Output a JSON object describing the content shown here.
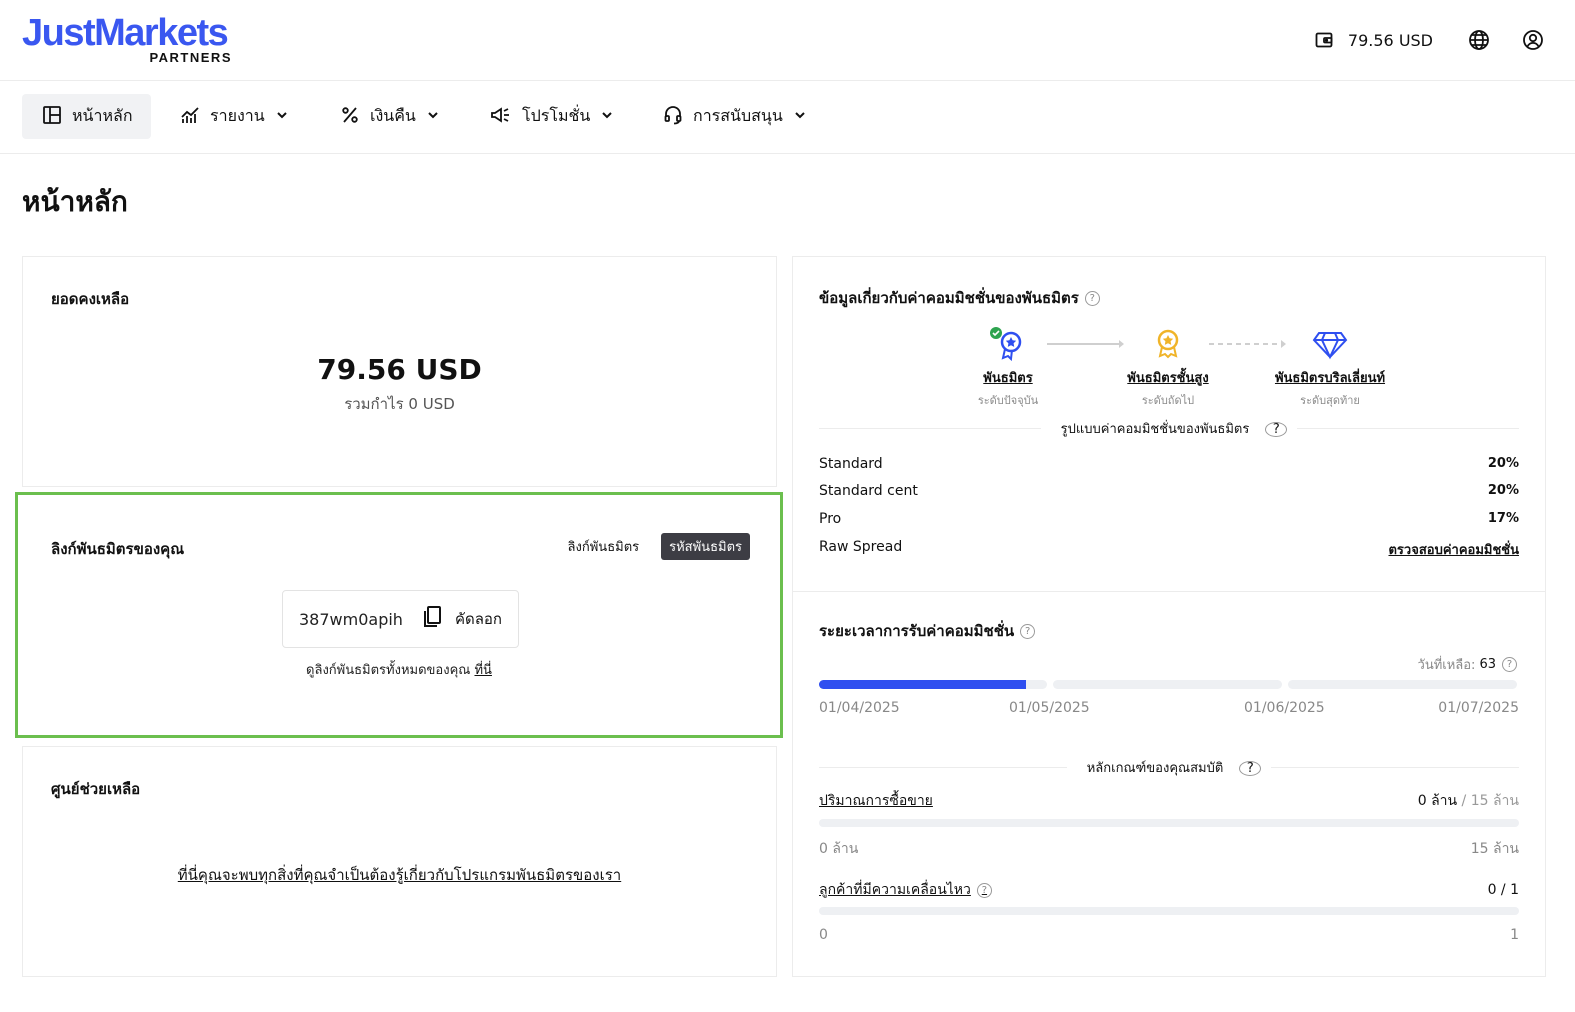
{
  "header": {
    "logo_main": "JustMarkets",
    "logo_sub": "PARTNERS",
    "balance": "79.56 USD"
  },
  "nav": {
    "items": [
      {
        "label": "หน้าหลัก",
        "icon": "dashboard-icon"
      },
      {
        "label": "รายงาน",
        "icon": "chart-icon"
      },
      {
        "label": "เงินคืน",
        "icon": "percent-icon"
      },
      {
        "label": "โปรโมชั่น",
        "icon": "megaphone-icon"
      },
      {
        "label": "การสนับสนุน",
        "icon": "headset-icon"
      }
    ]
  },
  "page": {
    "title": "หน้าหลัก"
  },
  "balance_card": {
    "title": "ยอดคงเหลือ",
    "value": "79.56 USD",
    "sub": "รวมกำไร 0 USD"
  },
  "link_card": {
    "title": "ลิงก์พันธมิตรของคุณ",
    "tab_link": "ลิงก์พันธมิตร",
    "tab_code": "รหัสพันธมิตร",
    "code": "387wm0apih",
    "copy_label": "คัดลอก",
    "see_all_prefix": "ดูลิงก์พันธมิตรทั้งหมดของคุณ",
    "see_all_link": "ที่นี่"
  },
  "help_card": {
    "title": "ศูนย์ช่วยเหลือ",
    "link": "ที่นี่คุณจะพบทุกสิ่งที่คุณจำเป็นต้องรู้เกี่ยวกับโปรแกรมพันธมิตรของเรา"
  },
  "commission_card": {
    "title": "ข้อมูลเกี่ยวกับค่าคอมมิชชั่นของพันธมิตร",
    "levels": [
      {
        "name": "พันธมิตร",
        "sub": "ระดับปัจจุบัน",
        "icon": "medal-icon"
      },
      {
        "name": "พันธมิตรชั้นสูง",
        "sub": "ระดับถัดไป",
        "icon": "gold-medal-icon"
      },
      {
        "name": "พันธมิตรบริลเลี่ยนท์",
        "sub": "ระดับสุดท้าย",
        "icon": "diamond-icon"
      }
    ],
    "rates_title": "รูปแบบค่าคอมมิชชั่นของพันธมิตร",
    "rates": [
      {
        "name": "Standard",
        "value": "20%"
      },
      {
        "name": "Standard cent",
        "value": "20%"
      },
      {
        "name": "Pro",
        "value": "17%"
      },
      {
        "name": "Raw Spread",
        "value": "ตรวจสอบค่าคอมมิชชั่น"
      }
    ],
    "period_title": "ระยะเวลาการรับค่าคอมมิชชั่น",
    "days_left_label": "วันที่เหลือ:",
    "days_left_value": "63",
    "dates": [
      "01/04/2025",
      "01/05/2025",
      "01/06/2025",
      "01/07/2025"
    ],
    "elapsed_fraction_first_month": 0.91,
    "criteria_title": "หลักเกณฑ์ของคุณสมบัติ",
    "criteria": [
      {
        "name": "ปริมาณการซื้อขาย",
        "current": "0 ล้าน",
        "target": "/ 15 ล้าน",
        "min": "0 ล้าน",
        "max": "15 ล้าน",
        "progress": 0
      },
      {
        "name": "ลูกค้าที่มีความเคลื่อนไหว",
        "current": "0 / 1",
        "target": "",
        "min": "0",
        "max": "1",
        "progress": 0
      }
    ]
  },
  "colors": {
    "brand": "#3a57f0",
    "highlight_border": "#6bbf4e",
    "progress": "#2f4ff0",
    "track": "#eef0f3"
  }
}
